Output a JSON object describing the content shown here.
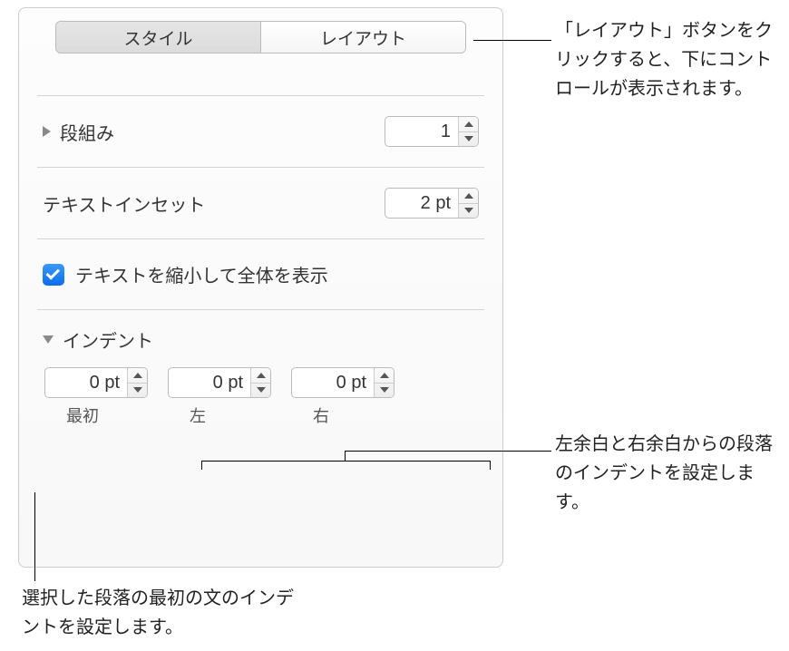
{
  "tabs": {
    "style": "スタイル",
    "layout": "レイアウト"
  },
  "columns": {
    "label": "段組み",
    "value": "1"
  },
  "textInset": {
    "label": "テキストインセット",
    "value": "2 pt"
  },
  "shrinkText": {
    "label": "テキストを縮小して全体を表示",
    "checked": true
  },
  "indent": {
    "label": "インデント",
    "first": {
      "value": "0 pt",
      "label": "最初"
    },
    "left": {
      "value": "0 pt",
      "label": "左"
    },
    "right": {
      "value": "0 pt",
      "label": "右"
    }
  },
  "callouts": {
    "layoutButton": "「レイアウト」ボタンをクリックすると、下にコントロールが表示されます。",
    "margins": "左余白と右余白からの段落のインデントを設定します。",
    "firstLine": "選択した段落の最初の文のインデントを設定します。"
  }
}
